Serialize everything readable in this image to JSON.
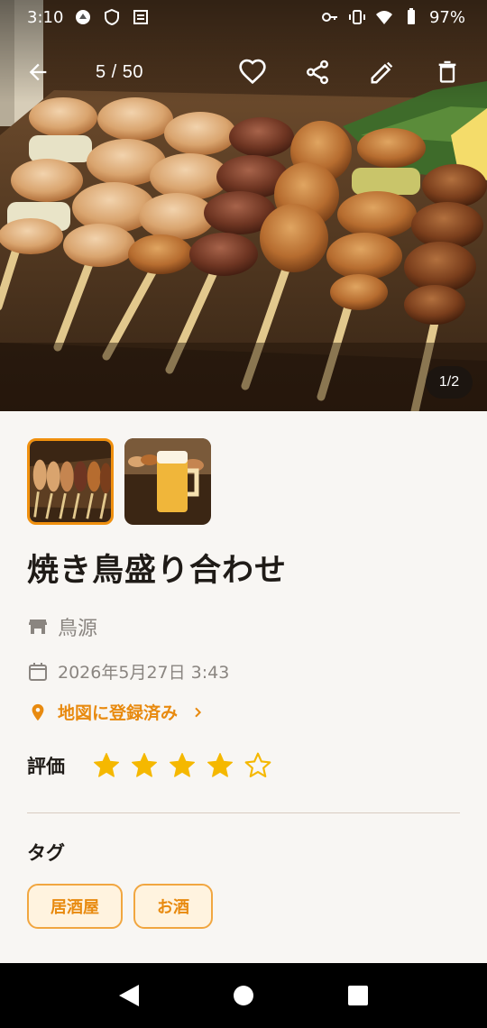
{
  "status_bar": {
    "time": "3:10",
    "battery": "97%",
    "icons": [
      "notification-icon",
      "shield-icon",
      "news-icon",
      "key-icon",
      "vibrate-icon",
      "wifi-icon",
      "battery-icon"
    ]
  },
  "toolbar": {
    "counter": "5 / 50",
    "icons": [
      "back-arrow-icon",
      "heart-icon",
      "share-icon",
      "edit-icon",
      "delete-icon"
    ]
  },
  "hero": {
    "page_indicator": "1/2"
  },
  "thumbnails": [
    {
      "name": "yakitori-thumbnail",
      "selected": true
    },
    {
      "name": "beer-thumbnail",
      "selected": false
    }
  ],
  "detail": {
    "title": "焼き鳥盛り合わせ",
    "shop": "鳥源",
    "date": "2026年5月27日 3:43",
    "map_status": "地図に登録済み"
  },
  "rating": {
    "label": "評価",
    "value": 4,
    "max": 5
  },
  "tags": {
    "label": "タグ",
    "items": [
      "居酒屋",
      "お酒"
    ]
  },
  "colors": {
    "accent": "#e88a0f",
    "star": "#f5b800",
    "chip_bg": "#fff3df",
    "chip_border": "#f1a640"
  },
  "nav": {
    "icons": [
      "nav-back-icon",
      "nav-home-icon",
      "nav-recents-icon"
    ]
  }
}
